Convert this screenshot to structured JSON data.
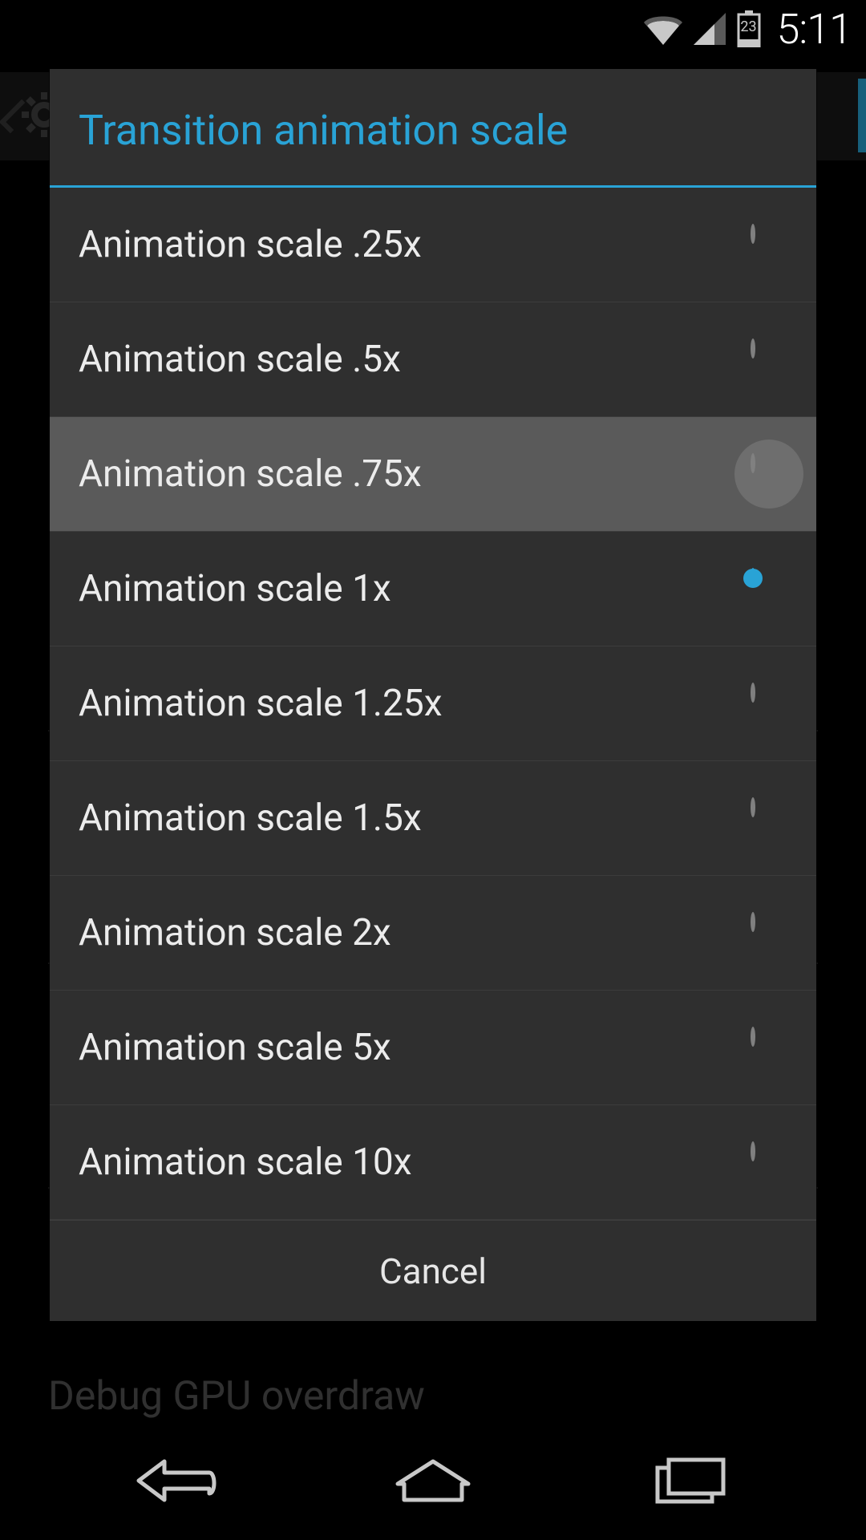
{
  "statusbar": {
    "battery_text": "23",
    "clock": "5:11"
  },
  "background": {
    "peek_item": "Debug GPU overdraw"
  },
  "dialog": {
    "title": "Transition animation scale",
    "cancel_label": "Cancel",
    "highlighted_index": 2,
    "selected_index": 3,
    "options": [
      {
        "label": "Animation scale .25x"
      },
      {
        "label": "Animation scale .5x"
      },
      {
        "label": "Animation scale .75x"
      },
      {
        "label": "Animation scale 1x"
      },
      {
        "label": "Animation scale 1.25x"
      },
      {
        "label": "Animation scale 1.5x"
      },
      {
        "label": "Animation scale 2x"
      },
      {
        "label": "Animation scale 5x"
      },
      {
        "label": "Animation scale 10x"
      }
    ]
  }
}
